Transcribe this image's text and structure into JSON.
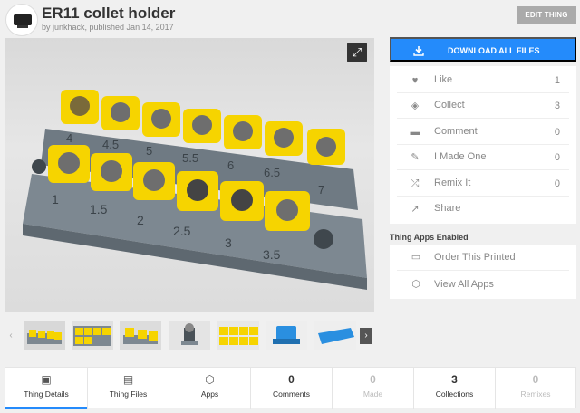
{
  "header": {
    "title": "ER11 collet holder",
    "byline": "by junkhack, published Jan 14, 2017",
    "edit_label": "EDIT THING"
  },
  "main_image": {
    "holder_labels_back": [
      "4",
      "4.5",
      "5",
      "5.5",
      "6",
      "6.5",
      "7"
    ],
    "holder_labels_front": [
      "1",
      "1.5",
      "2",
      "2.5",
      "3",
      "3.5"
    ],
    "expand_icon": "expand-icon"
  },
  "thumbnails": {
    "prev_icon": "chevron-left-icon",
    "next_icon": "chevron-right-icon",
    "count": 7
  },
  "download": {
    "label": "DOWNLOAD ALL FILES",
    "icon": "download-icon"
  },
  "stats": [
    {
      "icon": "heart-icon",
      "label": "Like",
      "count": "1"
    },
    {
      "icon": "collect-icon",
      "label": "Collect",
      "count": "3"
    },
    {
      "icon": "comment-icon",
      "label": "Comment",
      "count": "0"
    },
    {
      "icon": "made-one-icon",
      "label": "I Made One",
      "count": "0"
    },
    {
      "icon": "remix-icon",
      "label": "Remix It",
      "count": "0"
    },
    {
      "icon": "share-icon",
      "label": "Share",
      "count": ""
    }
  ],
  "apps": {
    "heading": "Thing Apps Enabled",
    "items": [
      {
        "icon": "printer-icon",
        "label": "Order This Printed"
      },
      {
        "icon": "cube-icon",
        "label": "View All Apps"
      }
    ]
  },
  "tabs": [
    {
      "label": "Thing Details",
      "icon": "details-icon",
      "active": true
    },
    {
      "label": "Thing Files",
      "icon": "folder-icon"
    },
    {
      "label": "Apps",
      "icon": "cube-icon"
    },
    {
      "label": "Comments",
      "count": "0"
    },
    {
      "label": "Made",
      "count": "0"
    },
    {
      "label": "Collections",
      "count": "3"
    },
    {
      "label": "Remixes",
      "count": "0"
    }
  ],
  "colors": {
    "accent": "#248bfb",
    "collet_yellow": "#f6d400",
    "holder_gray": "#7d8891"
  }
}
